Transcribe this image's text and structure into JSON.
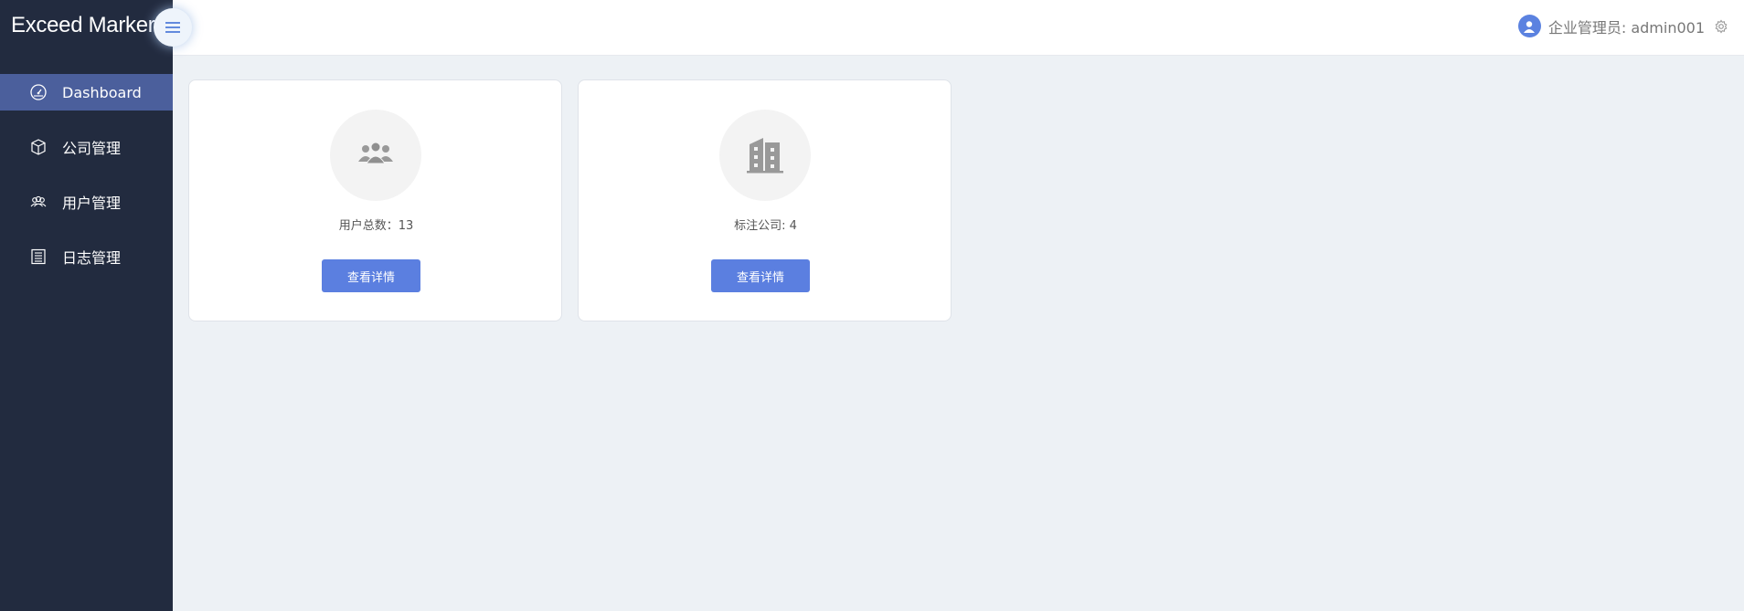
{
  "app": {
    "brand": "Exceed Marker"
  },
  "sidebar": {
    "items": [
      {
        "label": "Dashboard",
        "icon": "dashboard-gauge-icon",
        "active": true
      },
      {
        "label": "公司管理",
        "icon": "cube-icon",
        "active": false
      },
      {
        "label": "用户管理",
        "icon": "users-icon",
        "active": false
      },
      {
        "label": "日志管理",
        "icon": "log-list-icon",
        "active": false
      }
    ]
  },
  "header": {
    "user_label": "企业管理员: admin001",
    "avatar_icon": "user-avatar-icon",
    "settings_icon": "gear-icon"
  },
  "cards": [
    {
      "icon": "user-group-icon",
      "stat_text": "用户总数：13",
      "button_label": "查看详情"
    },
    {
      "icon": "building-icon",
      "stat_text": "标注公司: 4",
      "button_label": "查看详情"
    }
  ],
  "colors": {
    "sidebar_bg": "#222b3f",
    "active_item_bg": "#4b5f9c",
    "primary_button": "#5b7fe0",
    "page_bg": "#edf1f5"
  }
}
